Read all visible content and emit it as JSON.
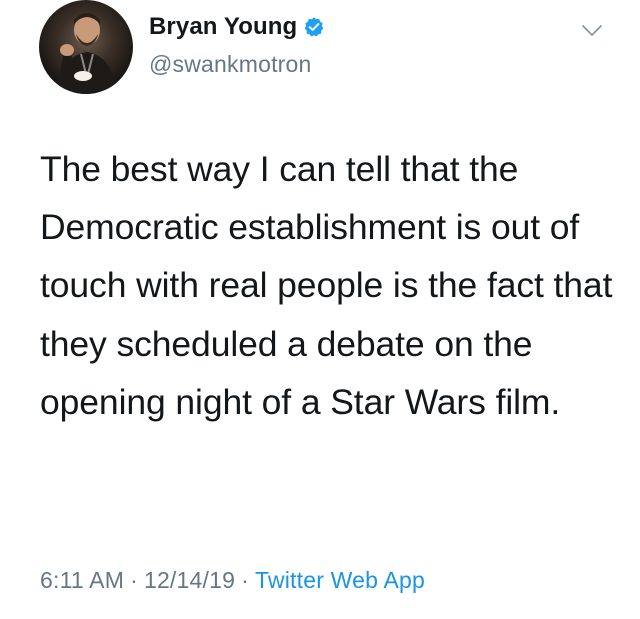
{
  "tweet": {
    "author": {
      "display_name": "Bryan Young",
      "handle": "@swankmotron",
      "verified": true,
      "verified_icon": "verified-badge-icon"
    },
    "text": "The best way I can tell that the Democratic establishment is out of touch with real people is the fact that they scheduled a debate on the opening night of a Star Wars film.",
    "time": "6:11 AM",
    "date": "12/14/19",
    "separator": "·",
    "source": "Twitter Web App"
  },
  "colors": {
    "text": "#14171a",
    "secondary": "#657786",
    "accent": "#1b95e0",
    "verified": "#1da1f2"
  }
}
